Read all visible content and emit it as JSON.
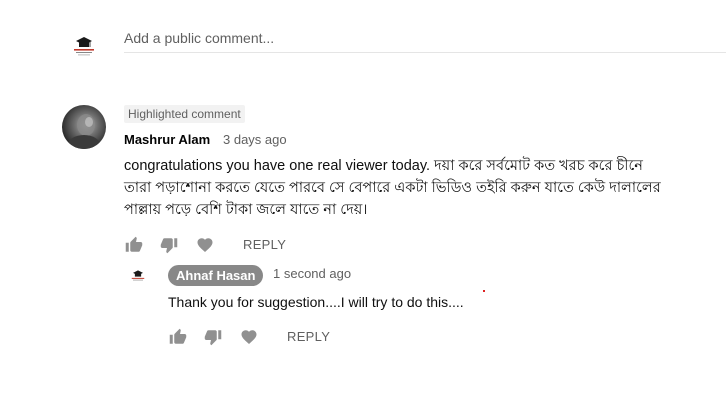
{
  "add_comment": {
    "placeholder": "Add a public comment..."
  },
  "comment": {
    "badge": "Highlighted comment",
    "author": "Mashrur Alam",
    "time": "3 days ago",
    "text": "congratulations you have one real viewer today. দয়া করে সর্বমোট কত খরচ করে চীনে\nতারা পড়াশোনা করতে যেতে পারবে সে বেপারে একটা ভিডিও তইরি করুন যাতে কেউ দালালের\nপাল্লায় পড়ে বেশি টাকা জলে যাতে না দেয়।",
    "reply_label": "REPLY"
  },
  "reply": {
    "author": "Ahnaf Hasan",
    "time": "1 second ago",
    "text": "Thank you for suggestion....I will try to do this....",
    "reply_label": "REPLY"
  },
  "icons": {
    "like": "thumb-up-icon",
    "dislike": "thumb-down-icon",
    "heart": "heart-icon"
  },
  "colors": {
    "owner_chip": "#888888",
    "secondary_text": "#606060",
    "icon": "#909090"
  }
}
